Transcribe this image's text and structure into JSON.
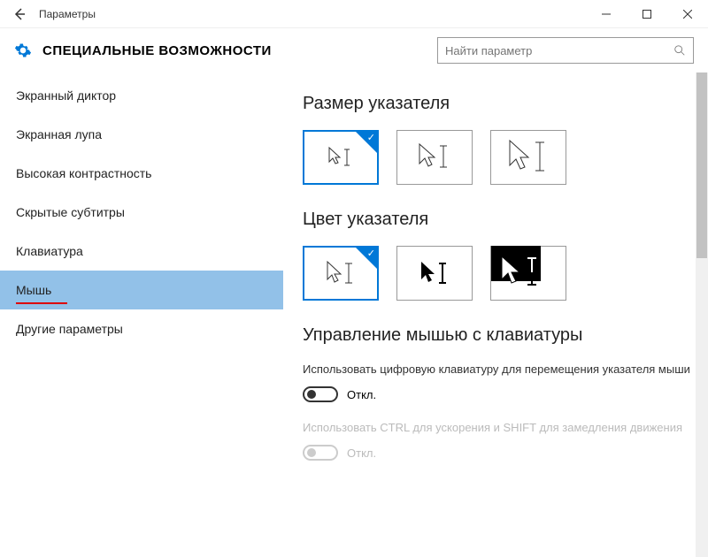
{
  "window": {
    "title": "Параметры"
  },
  "header": {
    "title": "СПЕЦИАЛЬНЫЕ ВОЗМОЖНОСТИ"
  },
  "search": {
    "placeholder": "Найти параметр"
  },
  "sidebar": {
    "items": [
      {
        "label": "Экранный диктор"
      },
      {
        "label": "Экранная лупа"
      },
      {
        "label": "Высокая контрастность"
      },
      {
        "label": "Скрытые субтитры"
      },
      {
        "label": "Клавиатура"
      },
      {
        "label": "Мышь"
      },
      {
        "label": "Другие параметры"
      }
    ]
  },
  "main": {
    "pointer_size_title": "Размер указателя",
    "pointer_color_title": "Цвет указателя",
    "mouse_keys_title": "Управление мышью с клавиатуры",
    "mouse_keys_desc": "Использовать цифровую клавиатуру для перемещения указателя мыши",
    "toggle_off": "Откл.",
    "ctrl_desc": "Использовать CTRL для ускорения и SHIFT для замедления движения",
    "toggle_off2": "Откл."
  }
}
